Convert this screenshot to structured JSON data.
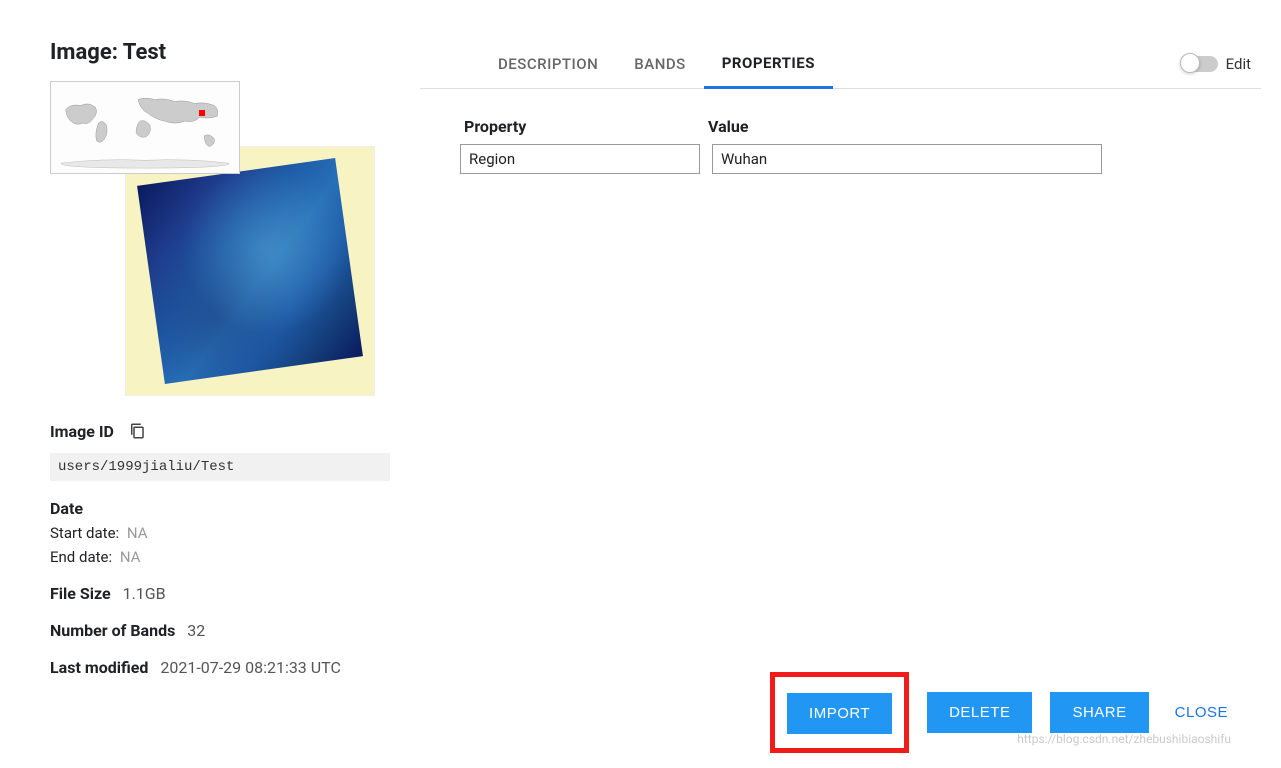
{
  "title": "Image: Test",
  "image_id_label": "Image ID",
  "image_id_value": "users/1999jialiu/Test",
  "date_label": "Date",
  "start_date_label": "Start date:",
  "start_date_value": "NA",
  "end_date_label": "End date:",
  "end_date_value": "NA",
  "file_size_label": "File Size",
  "file_size_value": "1.1GB",
  "bands_label": "Number of Bands",
  "bands_value": "32",
  "last_modified_label": "Last modified",
  "last_modified_value": "2021-07-29 08:21:33 UTC",
  "tabs": {
    "description": "DESCRIPTION",
    "bands": "BANDS",
    "properties": "PROPERTIES"
  },
  "edit_label": "Edit",
  "prop_header_key": "Property",
  "prop_header_val": "Value",
  "properties": [
    {
      "key": "Region",
      "value": "Wuhan"
    }
  ],
  "buttons": {
    "import": "IMPORT",
    "delete": "DELETE",
    "share": "SHARE",
    "close": "CLOSE"
  },
  "watermark": "https://blog.csdn.net/zhebushibiaoshifu"
}
